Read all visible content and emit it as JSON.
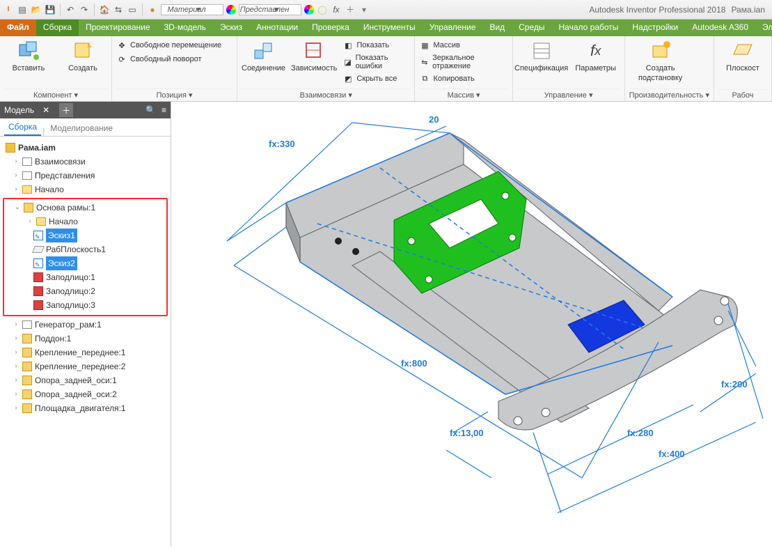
{
  "title": {
    "app": "Autodesk Inventor Professional 2018",
    "doc": "Рама.ian"
  },
  "qat": {
    "material_ph": "Материал",
    "appearance_ph": "Представлен",
    "fx": "fx"
  },
  "tabs": {
    "file": "Файл",
    "assembly": "Сборка",
    "design": "Проектирование",
    "model3d": "3D-модель",
    "sketch": "Эскиз",
    "annotate": "Аннотации",
    "inspect": "Проверка",
    "tools": "Инструменты",
    "manage": "Управление",
    "view": "Вид",
    "env": "Среды",
    "getstarted": "Начало работы",
    "addins": "Надстройки",
    "a360": "Autodesk A360",
    "electro": "Эле"
  },
  "ribbon": {
    "component": {
      "insert": "Вставить",
      "create": "Создать",
      "group": "Компонент ▾"
    },
    "position": {
      "free_move": "Свободное перемещение",
      "free_rot": "Свободный поворот",
      "group": "Позиция ▾"
    },
    "relations": {
      "connect": "Соединение",
      "constrain": "Зависимость",
      "show": "Показать",
      "show_err": "Показать ошибки",
      "hide_all": "Скрыть все",
      "group": "Взаимосвязи ▾"
    },
    "pattern": {
      "array": "Массив",
      "mirror": "Зеркальное отражение",
      "copy": "Копировать",
      "group": "Массив ▾"
    },
    "manage": {
      "bom": "Спецификация",
      "params": "Параметры",
      "group": "Управление ▾"
    },
    "productivity": {
      "create_sub": "Создать",
      "create_sub2": "подстановку",
      "group": "Производительность ▾"
    },
    "workfeat": {
      "plane": "Плоскост",
      "group": "Рабоч"
    }
  },
  "panel": {
    "title": "Модель",
    "sub_active": "Сборка",
    "sub_other": "Моделирование",
    "root": "Рама.iam",
    "n1": "Взаимосвязи",
    "n2": "Представления",
    "n3": "Начало",
    "osn": "Основа рамы:1",
    "osn_start": "Начало",
    "osn_sk1": "Эскиз1",
    "osn_wp": "РабПлоскость1",
    "osn_sk2": "Эскиз2",
    "osn_f1": "Заподлицо:1",
    "osn_f2": "Заподлицо:2",
    "osn_f3": "Заподлицо:3",
    "gen": "Генератор_рам:1",
    "poddon": "Поддон:1",
    "kp1": "Крепление_переднее:1",
    "kp2": "Крепление_переднее:2",
    "oz1": "Опора_задней_оси:1",
    "oz2": "Опора_задней_оси:2",
    "pd": "Площадка_двигателя:1"
  },
  "dims": {
    "d330": "fx:330",
    "d20": "20",
    "d800": "fx:800",
    "d13": "fx:13,00",
    "d280": "fx:280",
    "d200": "fx:200",
    "d400": "fx:400"
  }
}
